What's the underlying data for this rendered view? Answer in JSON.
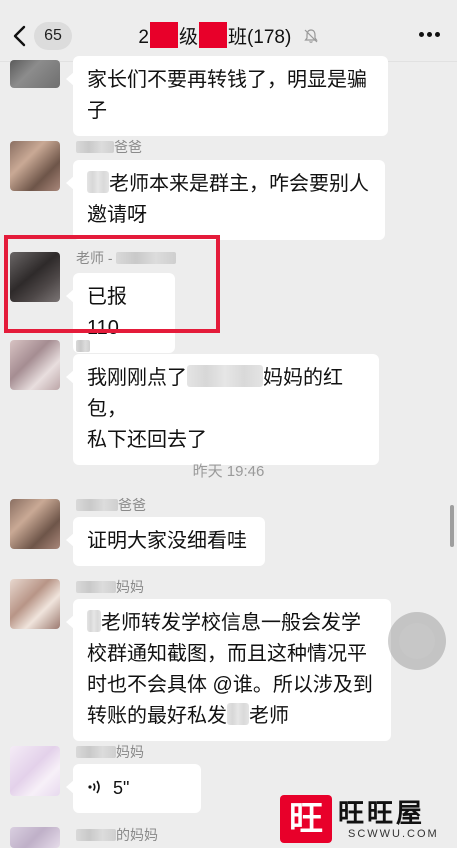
{
  "header": {
    "unread_count": "65",
    "title_prefix": "2",
    "title_middle": "级",
    "title_suffix": "班(178)"
  },
  "messages": [
    {
      "sender": "",
      "lines": [
        "家长们不要再转钱了，明显是骗",
        "子"
      ]
    },
    {
      "sender": "爸爸",
      "lines": [
        "老师本来是群主，咋会要别人",
        "邀请呀"
      ]
    },
    {
      "sender": "老师 -",
      "lines": [
        "已报 110"
      ]
    },
    {
      "sender": "",
      "lines": [
        "我刚刚点了",
        "妈妈的红包，",
        "私下还回去了"
      ]
    },
    {
      "sender": "爸爸",
      "lines": [
        "证明大家没细看哇"
      ]
    },
    {
      "sender": "妈妈",
      "lines": [
        "老师转发学校信息一般会发学",
        "校群通知截图，而且这种情况平",
        "时也不会具体 @谁。所以涉及到",
        "转账的最好私发",
        "老师"
      ]
    },
    {
      "sender": "妈妈",
      "voice_duration": "5\""
    },
    {
      "sender": "的妈妈"
    }
  ],
  "time_divider": "昨天 19:46",
  "watermark": {
    "logo_char": "旺",
    "text": "旺旺屋",
    "domain": "SCWWU.COM"
  },
  "colors": {
    "background": "#ededed",
    "bubble": "#ffffff",
    "highlight": "#e41b3a",
    "redaction": "#e8002a"
  }
}
